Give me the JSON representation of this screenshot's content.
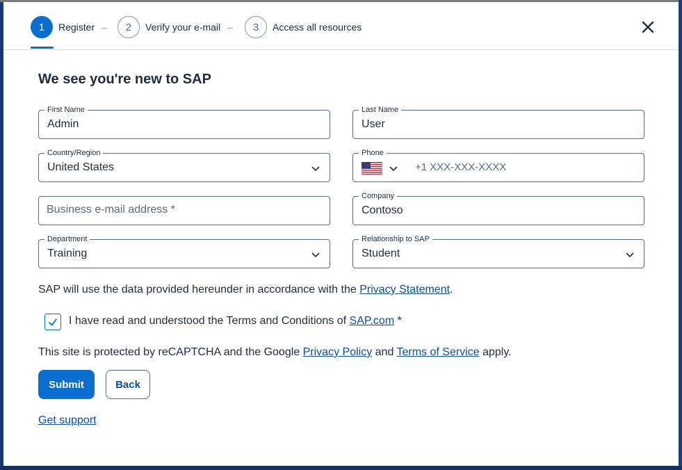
{
  "stepper": {
    "steps": [
      {
        "number": "1",
        "label": "Register",
        "separator": "–"
      },
      {
        "number": "2",
        "label": "Verify your e-mail",
        "separator": "–"
      },
      {
        "number": "3",
        "label": "Access all resources"
      }
    ]
  },
  "page_title": "We see you're new to SAP",
  "form": {
    "first_name": {
      "label": "First Name",
      "value": "Admin"
    },
    "last_name": {
      "label": "Last Name",
      "value": "User"
    },
    "country": {
      "label": "Country/Region",
      "value": "United States"
    },
    "phone": {
      "label": "Phone",
      "placeholder": "+1 XXX-XXX-XXXX",
      "country_flag": "us-flag"
    },
    "business_email": {
      "placeholder": "Business e-mail address *",
      "value": ""
    },
    "company": {
      "label": "Company",
      "value": "Contoso"
    },
    "department": {
      "label": "Department",
      "value": "Training"
    },
    "relationship": {
      "label": "Relationship to SAP",
      "value": "Student"
    }
  },
  "privacy_notice": {
    "prefix": "SAP will use the data provided hereunder in accordance with the ",
    "link": "Privacy Statement",
    "suffix": "."
  },
  "terms": {
    "checked": true,
    "prefix": "I have read and understood the Terms and Conditions of ",
    "link": "SAP.com",
    "suffix": " *"
  },
  "recaptcha": {
    "prefix": "This site is protected by reCAPTCHA and the Google ",
    "link1": "Privacy Policy",
    "middle": " and ",
    "link2": "Terms of Service",
    "suffix": " apply."
  },
  "buttons": {
    "submit": "Submit",
    "back": "Back"
  },
  "support_link": "Get support",
  "colors": {
    "accent": "#0a6ed1",
    "link": "#0a4ea0",
    "text": "#1d2d3e"
  }
}
